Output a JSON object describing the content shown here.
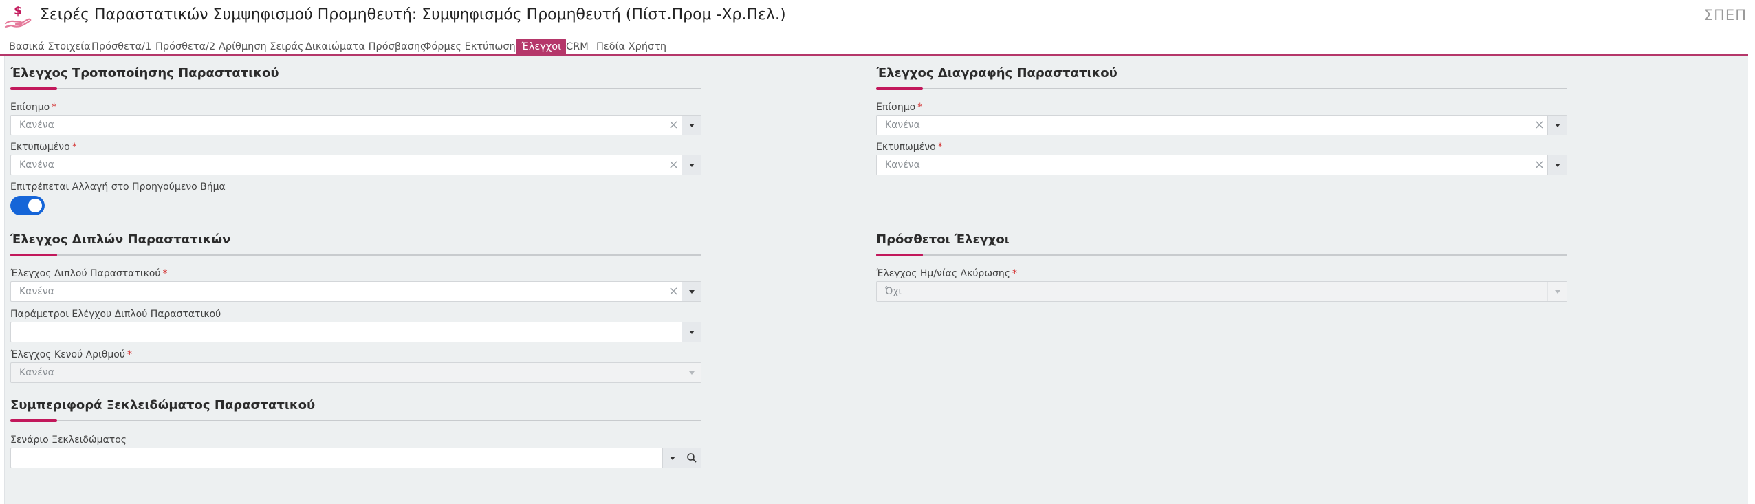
{
  "header": {
    "title": "Σειρές Παραστατικών Συμψηφισμού Προμηθευτή: Συμψηφισμός Προμηθευτή (Πίστ.Προμ -Χρ.Πελ.)",
    "org_code": "ΣΠΕΠ",
    "icon": "hand-dollar-icon"
  },
  "tabs": [
    {
      "label": "Βασικά Στοιχεία"
    },
    {
      "label": "Πρόσθετα/1"
    },
    {
      "label": "Πρόσθετα/2"
    },
    {
      "label": "Αρίθμηση Σειράς"
    },
    {
      "label": "Δικαιώματα Πρόσβασης"
    },
    {
      "label": "Φόρμες Εκτύπωσης"
    },
    {
      "label": "Έλεγχοι",
      "active": true
    },
    {
      "label": "CRM"
    },
    {
      "label": "Πεδία Χρήστη"
    }
  ],
  "sections": {
    "modify": {
      "title": "Έλεγχος Τροποποίησης Παραστατικού",
      "official_label": "Επίσημο",
      "official_value": "Κανένα",
      "printed_label": "Εκτυπωμένο",
      "printed_value": "Κανένα",
      "allow_prev_step_label": "Επιτρέπεται Αλλαγή στο Προηγούμενο Βήμα",
      "allow_prev_step_on": true
    },
    "delete": {
      "title": "Έλεγχος Διαγραφής Παραστατικού",
      "official_label": "Επίσημο",
      "official_value": "Κανένα",
      "printed_label": "Εκτυπωμένο",
      "printed_value": "Κανένα"
    },
    "duplicates": {
      "title": "Έλεγχος Διπλών Παραστατικών",
      "dup_check_label": "Έλεγχος Διπλού Παραστατικού",
      "dup_check_value": "Κανένα",
      "dup_params_label": "Παράμετροι Ελέγχου Διπλού Παραστατικού",
      "dup_params_value": "",
      "gap_check_label": "Έλεγχος Κενού Αριθμού",
      "gap_check_value": "Κανένα"
    },
    "extra": {
      "title": "Πρόσθετοι Έλεγχοι",
      "cancel_date_label": "Έλεγχος Ημ/νίας Ακύρωσης",
      "cancel_date_value": "Όχι"
    },
    "unlock": {
      "title": "Συμπεριφορά Ξεκλειδώματος Παραστατικού",
      "scenario_label": "Σενάριο Ξεκλειδώματος",
      "scenario_value": ""
    }
  },
  "required_mark": "*",
  "clear_glyph": "×",
  "colors": {
    "accent": "#b5376a",
    "rule_accent": "#c2185b",
    "toggle_on": "#1565d8",
    "required": "#d32f2f"
  }
}
